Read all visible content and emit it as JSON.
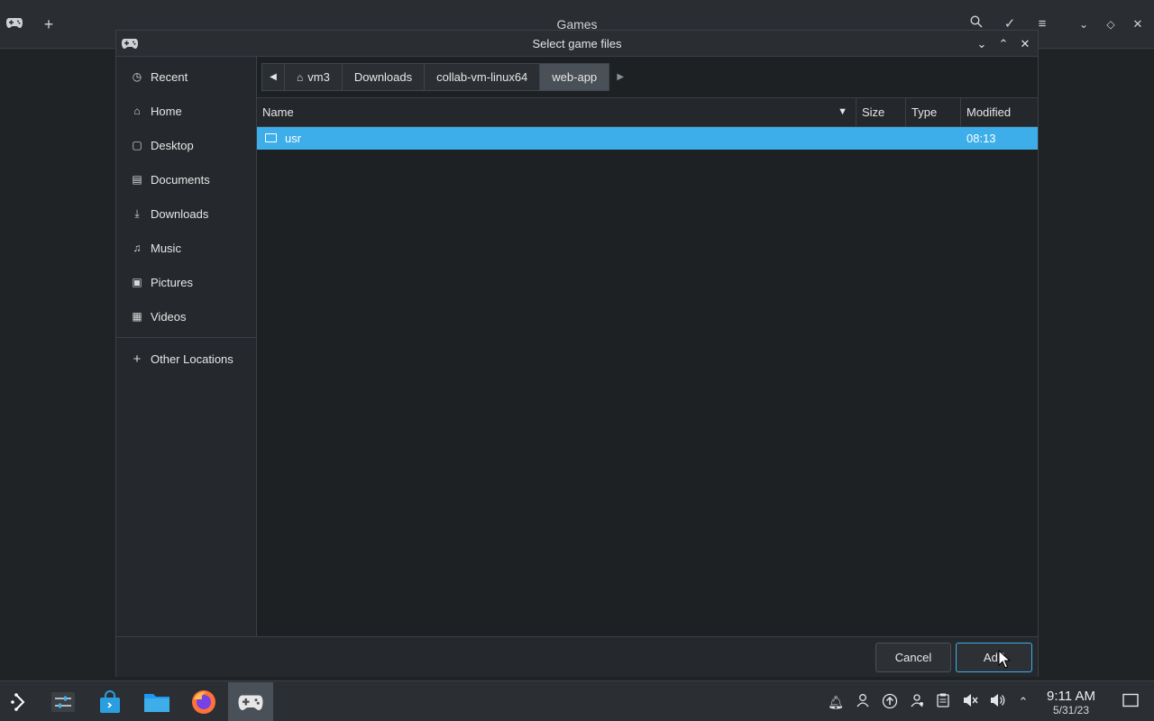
{
  "background_window": {
    "title": "Games",
    "icons": [
      "gamepad-icon",
      "plus-icon",
      "search-icon",
      "check-icon",
      "menu-icon",
      "minimize-icon",
      "maximize-icon",
      "close-icon"
    ]
  },
  "dialog": {
    "title": "Select game files",
    "sidebar": [
      {
        "label": "Recent",
        "icon": "recent-icon"
      },
      {
        "label": "Home",
        "icon": "home-icon"
      },
      {
        "label": "Desktop",
        "icon": "desktop-icon"
      },
      {
        "label": "Documents",
        "icon": "documents-icon"
      },
      {
        "label": "Downloads",
        "icon": "downloads-icon"
      },
      {
        "label": "Music",
        "icon": "music-icon"
      },
      {
        "label": "Pictures",
        "icon": "pictures-icon"
      },
      {
        "label": "Videos",
        "icon": "videos-icon"
      },
      {
        "label": "Other Locations",
        "icon": "plus-icon"
      }
    ],
    "path": [
      "vm3",
      "Downloads",
      "collab-vm-linux64",
      "web-app"
    ],
    "columns": {
      "name": "Name",
      "size": "Size",
      "type": "Type",
      "modified": "Modified"
    },
    "files": [
      {
        "name": "usr",
        "size": "",
        "type": "",
        "modified": "08:13",
        "selected": true
      }
    ],
    "buttons": {
      "cancel": "Cancel",
      "add": "Add"
    }
  },
  "taskbar": {
    "time": "9:11 AM",
    "date": "5/31/23"
  },
  "colors": {
    "accent": "#3daee9",
    "background": "#23272d"
  }
}
